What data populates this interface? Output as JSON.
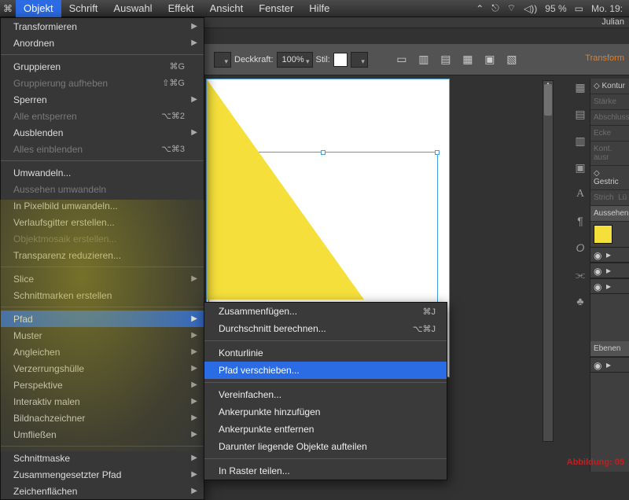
{
  "menubar": {
    "items": [
      "Objekt",
      "Schrift",
      "Auswahl",
      "Effekt",
      "Ansicht",
      "Fenster",
      "Hilfe"
    ],
    "active_index": 0,
    "status": {
      "battery": "95 %",
      "clock": "Mo. 19:"
    }
  },
  "window": {
    "tab": "Julian"
  },
  "propbar": {
    "opacity_label": "Deckkraft:",
    "opacity_value": "100%",
    "style_label": "Stil:",
    "transform_link": "Transform"
  },
  "objekt_menu": {
    "items": [
      {
        "label": "Transformieren",
        "arrow": true
      },
      {
        "label": "Anordnen",
        "arrow": true
      },
      "sep",
      {
        "label": "Gruppieren",
        "shortcut": "⌘G"
      },
      {
        "label": "Gruppierung aufheben",
        "shortcut": "⇧⌘G",
        "disabled": true
      },
      {
        "label": "Sperren",
        "arrow": true
      },
      {
        "label": "Alle entsperren",
        "shortcut": "⌥⌘2",
        "disabled": true
      },
      {
        "label": "Ausblenden",
        "arrow": true
      },
      {
        "label": "Alles einblenden",
        "shortcut": "⌥⌘3",
        "disabled": true
      },
      "sep",
      {
        "label": "Umwandeln..."
      },
      {
        "label": "Aussehen umwandeln",
        "disabled": true
      },
      {
        "label": "In Pixelbild umwandeln..."
      },
      {
        "label": "Verlaufsgitter erstellen..."
      },
      {
        "label": "Objektmosaik erstellen...",
        "disabled": true
      },
      {
        "label": "Transparenz reduzieren..."
      },
      "sep",
      {
        "label": "Slice",
        "arrow": true
      },
      {
        "label": "Schnittmarken erstellen"
      },
      "sep",
      {
        "label": "Pfad",
        "arrow": true,
        "highlight": true
      },
      {
        "label": "Muster",
        "arrow": true
      },
      {
        "label": "Angleichen",
        "arrow": true
      },
      {
        "label": "Verzerrungshülle",
        "arrow": true
      },
      {
        "label": "Perspektive",
        "arrow": true
      },
      {
        "label": "Interaktiv malen",
        "arrow": true
      },
      {
        "label": "Bildnachzeichner",
        "arrow": true
      },
      {
        "label": "Umfließen",
        "arrow": true
      },
      "sep",
      {
        "label": "Schnittmaske",
        "arrow": true
      },
      {
        "label": "Zusammengesetzter Pfad",
        "arrow": true
      },
      {
        "label": "Zeichenflächen",
        "arrow": true
      }
    ]
  },
  "pfad_submenu": {
    "items": [
      {
        "label": "Zusammenfügen...",
        "shortcut": "⌘J"
      },
      {
        "label": "Durchschnitt berechnen...",
        "shortcut": "⌥⌘J"
      },
      "sep",
      {
        "label": "Konturlinie"
      },
      {
        "label": "Pfad verschieben...",
        "highlight": true
      },
      "sep",
      {
        "label": "Vereinfachen..."
      },
      {
        "label": "Ankerpunkte hinzufügen"
      },
      {
        "label": "Ankerpunkte entfernen"
      },
      {
        "label": "Darunter liegende Objekte aufteilen"
      },
      "sep",
      {
        "label": "In Raster teilen..."
      }
    ]
  },
  "right": {
    "p_kontur": "Kontur",
    "p_staerke": "Stärke",
    "p_abschluss": "Abschluss",
    "p_ecke": "Ecke",
    "p_kontausr": "Kont. ausr",
    "p_gestrich": "Gestric",
    "p_strich": "Strich",
    "p_lu": "Lü",
    "p_aussehen": "Aussehen",
    "p_ebenen": "Ebenen",
    "caption": "Abbildung: 05"
  }
}
